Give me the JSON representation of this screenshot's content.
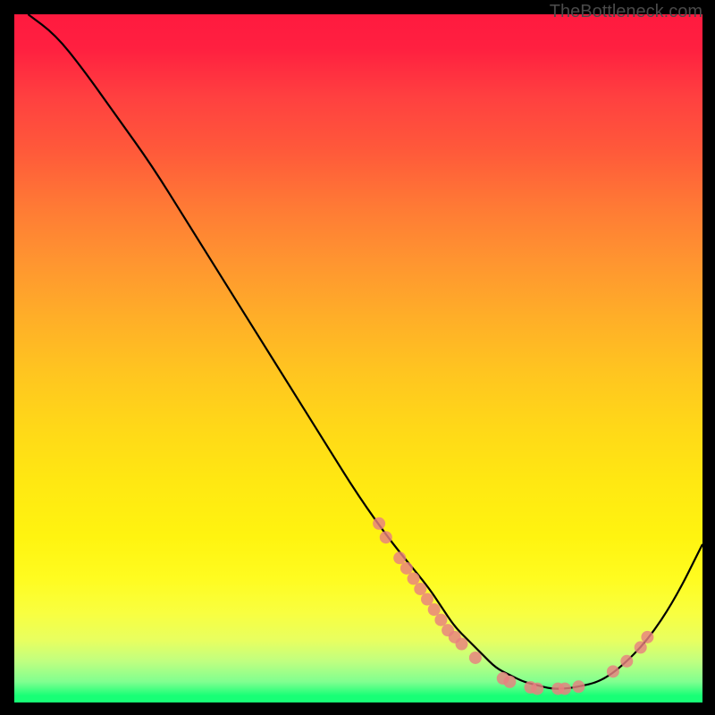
{
  "watermark": "TheBottleneck.com",
  "chart_data": {
    "type": "line",
    "title": "",
    "xlabel": "",
    "ylabel": "",
    "xlim": [
      0,
      100
    ],
    "ylim": [
      0,
      100
    ],
    "series": [
      {
        "name": "curve",
        "x": [
          2,
          6,
          10,
          15,
          20,
          25,
          30,
          35,
          40,
          45,
          50,
          55,
          60,
          62,
          64,
          66,
          68,
          70,
          72,
          74,
          76,
          78,
          80,
          82,
          85,
          88,
          92,
          96,
          100
        ],
        "y": [
          100,
          97,
          92,
          85,
          78,
          70,
          62,
          54,
          46,
          38,
          30,
          23,
          17,
          14,
          11,
          9,
          7,
          5,
          4,
          3,
          2.5,
          2,
          2,
          2.3,
          3,
          5,
          9,
          15,
          23
        ],
        "color": "#000000"
      }
    ],
    "markers": [
      {
        "x": 53,
        "y": 26
      },
      {
        "x": 54,
        "y": 24
      },
      {
        "x": 56,
        "y": 21
      },
      {
        "x": 57,
        "y": 19.5
      },
      {
        "x": 58,
        "y": 18
      },
      {
        "x": 59,
        "y": 16.5
      },
      {
        "x": 60,
        "y": 15
      },
      {
        "x": 61,
        "y": 13.5
      },
      {
        "x": 62,
        "y": 12
      },
      {
        "x": 63,
        "y": 10.5
      },
      {
        "x": 64,
        "y": 9.5
      },
      {
        "x": 65,
        "y": 8.5
      },
      {
        "x": 67,
        "y": 6.5
      },
      {
        "x": 71,
        "y": 3.5
      },
      {
        "x": 72,
        "y": 3
      },
      {
        "x": 75,
        "y": 2.2
      },
      {
        "x": 76,
        "y": 2
      },
      {
        "x": 79,
        "y": 2
      },
      {
        "x": 80,
        "y": 2
      },
      {
        "x": 82,
        "y": 2.3
      },
      {
        "x": 87,
        "y": 4.5
      },
      {
        "x": 89,
        "y": 6
      },
      {
        "x": 91,
        "y": 8
      },
      {
        "x": 92,
        "y": 9.5
      }
    ]
  }
}
